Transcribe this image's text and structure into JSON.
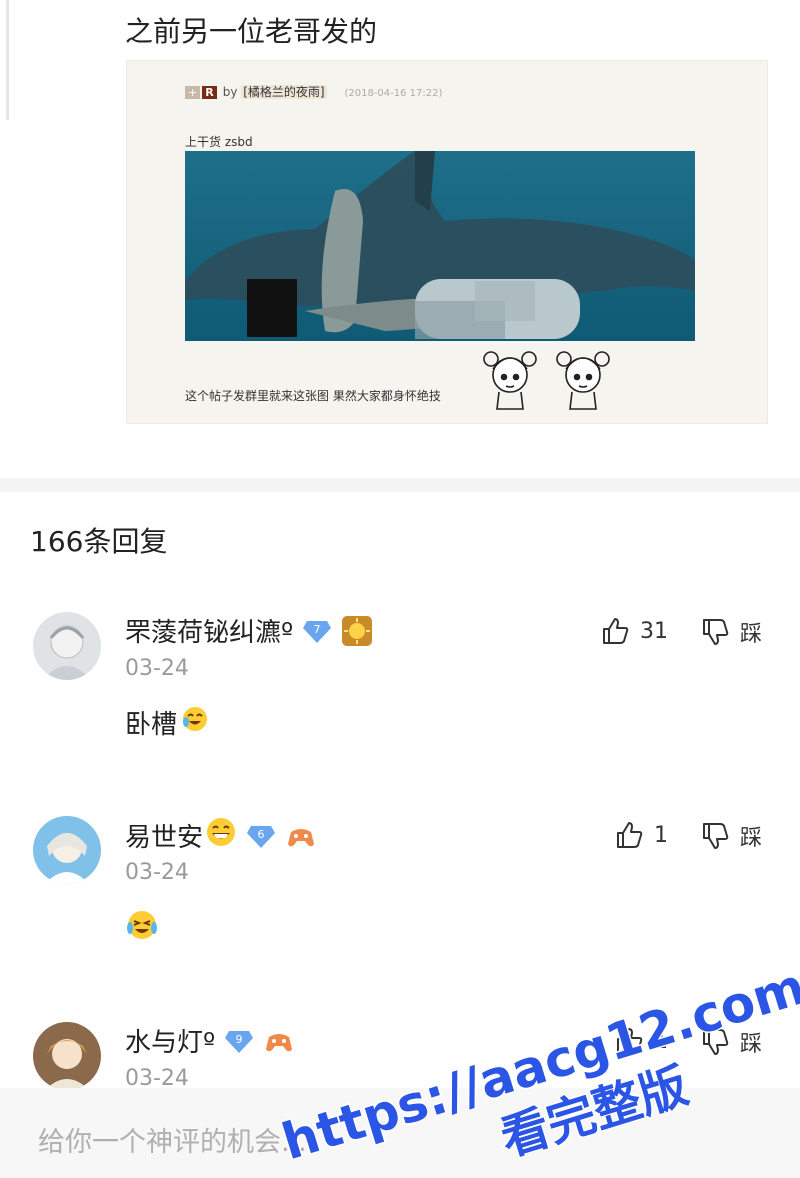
{
  "post": {
    "text": "之前另一位老哥发的",
    "quote": {
      "header_tag": "+",
      "header_r": "R",
      "header_by": "by",
      "header_name": "[橘格兰的夜雨]",
      "header_time": "(2018-04-16 17:22)",
      "line1": "上干货 zsbd",
      "caption": "这个帖子发群里就来这张图 果然大家都身怀绝技"
    }
  },
  "replies": {
    "count_label": "166条回复"
  },
  "comments": [
    {
      "username": "罘蔆荷铋纠瀌º",
      "level": "7",
      "date": "03-24",
      "text": "卧槽",
      "likes": "31",
      "dislike_label": "踩",
      "emoji": "crying-laugh",
      "badge": "gold-sun"
    },
    {
      "username": "易世安",
      "level": "6",
      "date": "03-24",
      "text": "",
      "likes": "1",
      "dislike_label": "踩",
      "emoji": "laughing-cry",
      "badge": "orange-game"
    },
    {
      "username": "水与灯º",
      "level": "9",
      "date": "03-24",
      "text": "",
      "likes": "1",
      "dislike_label": "踩",
      "badge": "orange-game"
    }
  ],
  "input": {
    "placeholder": "给你一个神评的机会..."
  },
  "watermark": {
    "line1": "https://aacg12.com",
    "line2": "看完整版"
  },
  "colors": {
    "level_badge": "#6aa6f0",
    "watermark": "#2a55e5"
  }
}
